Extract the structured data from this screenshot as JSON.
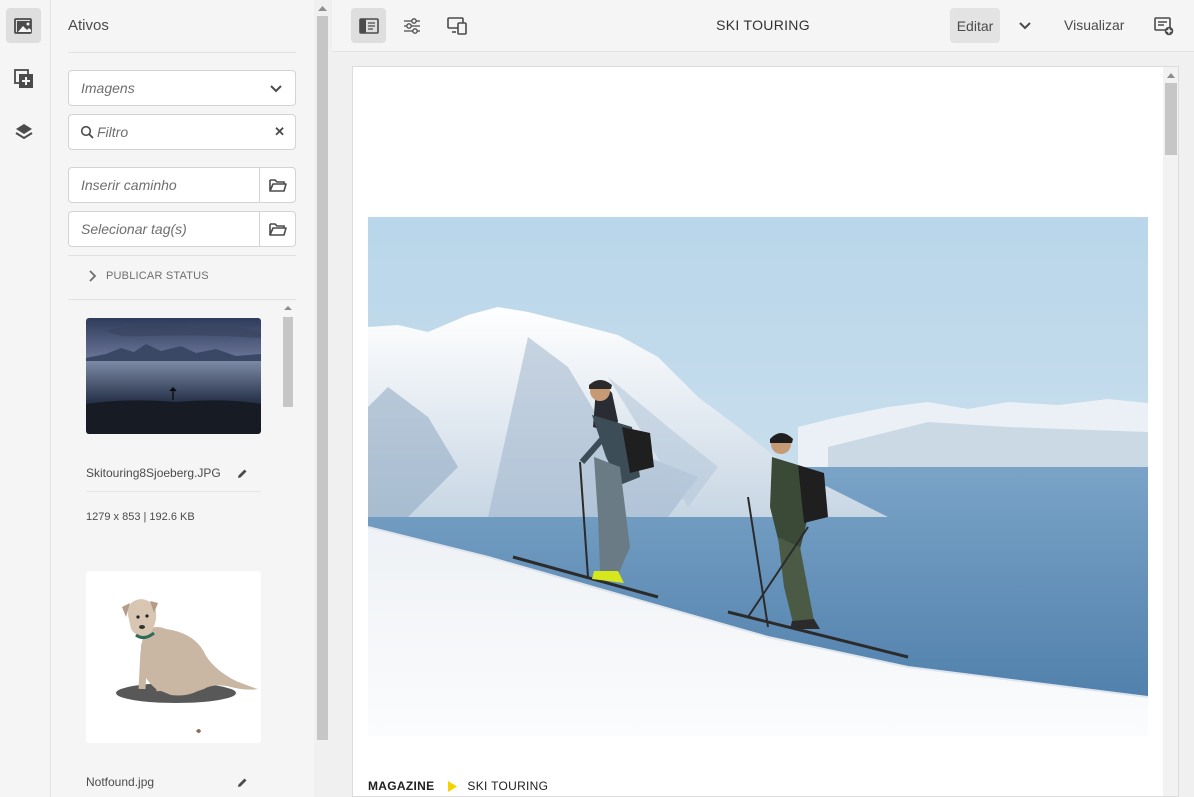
{
  "rail": {
    "items": [
      {
        "icon": "assets-icon",
        "active": true
      },
      {
        "icon": "add-component-icon",
        "active": false
      },
      {
        "icon": "layers-icon",
        "active": false
      }
    ]
  },
  "panel": {
    "title": "Ativos",
    "type_select": {
      "value": "Imagens"
    },
    "filter": {
      "placeholder": "Filtro"
    },
    "path": {
      "placeholder": "Inserir caminho"
    },
    "tags": {
      "placeholder": "Selecionar tag(s)"
    },
    "publish_status": "PUBLICAR STATUS",
    "assets": [
      {
        "name": "Skitouring8Sjoeberg.JPG",
        "meta": "1279 x 853 | 192.6 KB"
      },
      {
        "name": "Notfound.jpg",
        "meta": ""
      }
    ]
  },
  "toolbar": {
    "title": "SKI TOURING",
    "edit_label": "Editar",
    "preview_label": "Visualizar"
  },
  "page": {
    "breadcrumb": [
      "MAGAZINE",
      "SKI TOURING"
    ]
  },
  "colors": {
    "accent_yellow": "#f5d300",
    "sky": "#bcd8ea",
    "sea": "#5e8fb8"
  }
}
